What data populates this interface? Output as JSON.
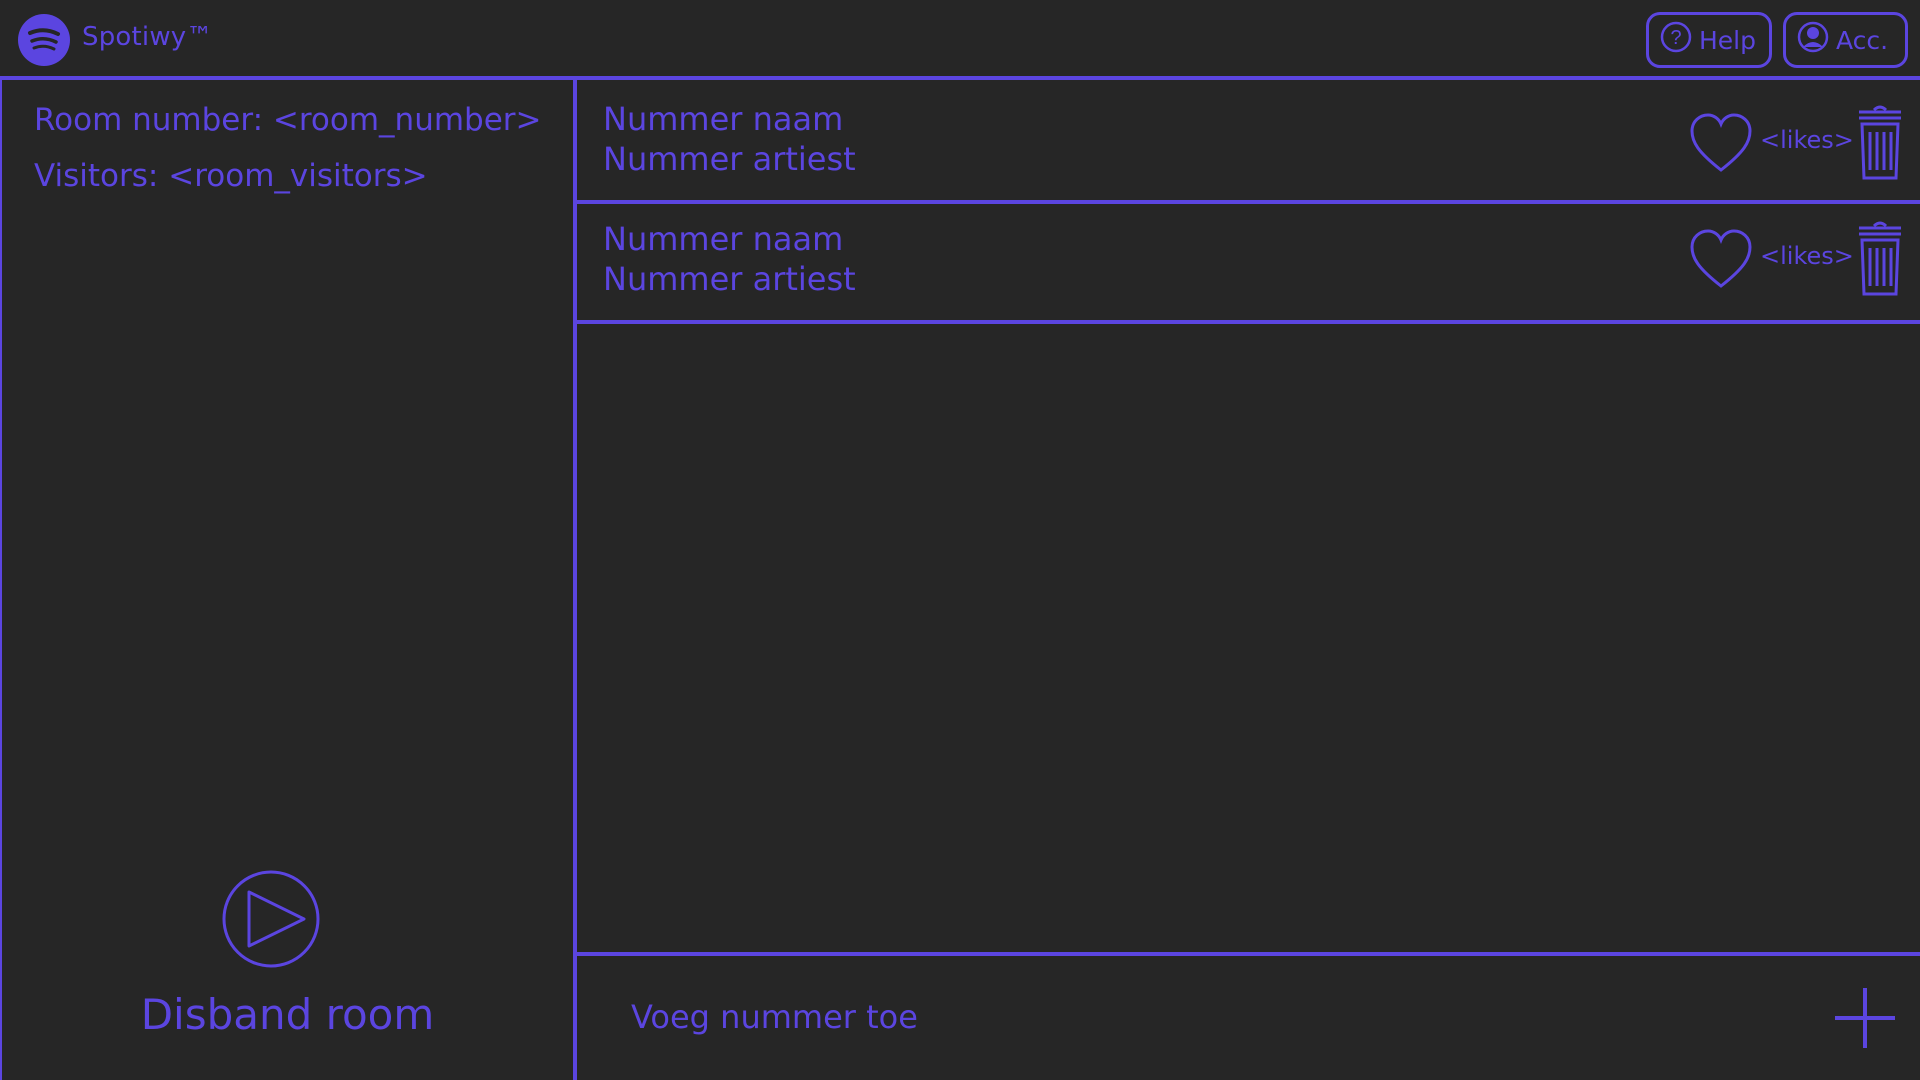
{
  "app": {
    "title": "Spotiwy™",
    "accent": "#5b45e0",
    "background": "#262626"
  },
  "topbar": {
    "help_label": "Help",
    "account_label": "Acc."
  },
  "room": {
    "number_text": "Room number: <room_number>",
    "visitors_text": "Visitors: <room_visitors>",
    "disband_label": "Disband room"
  },
  "queue": {
    "items": [
      {
        "name": "Nummer naam",
        "artist": "Nummer artiest",
        "likes": "<likes>"
      },
      {
        "name": "Nummer naam",
        "artist": "Nummer artiest",
        "likes": "<likes>"
      }
    ],
    "add_label": "Voeg nummer toe"
  },
  "icons": [
    "spotify-logo-icon",
    "help-icon",
    "account-icon",
    "heart-icon",
    "trash-icon",
    "play-icon",
    "plus-icon"
  ]
}
